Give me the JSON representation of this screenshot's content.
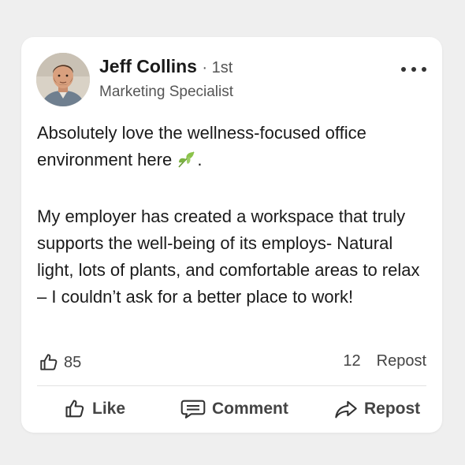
{
  "post": {
    "author": {
      "name": "Jeff Collins",
      "degree": "· 1st",
      "title": "Marketing Specialist",
      "avatar_icon": "person-avatar"
    },
    "more_icon": "ellipsis-icon",
    "body": {
      "paragraph1": "Absolutely love the wellness-focused office environment here",
      "paragraph1_end": ".",
      "emoji": "leaf-emoji",
      "paragraph2": "My employer has created a workspace that truly supports the well-being of its employs- Natural light, lots of plants, and comfortable areas to relax – I couldn’t ask for a better place to work!"
    },
    "stats": {
      "likes": "85",
      "comments": "12",
      "repost_label": "Repost"
    },
    "actions": {
      "like": "Like",
      "comment": "Comment",
      "repost": "Repost"
    }
  },
  "colors": {
    "background": "#efefef",
    "card": "#ffffff",
    "text": "#1a1a1a",
    "muted": "#555555",
    "leaf": "#7cb342"
  }
}
